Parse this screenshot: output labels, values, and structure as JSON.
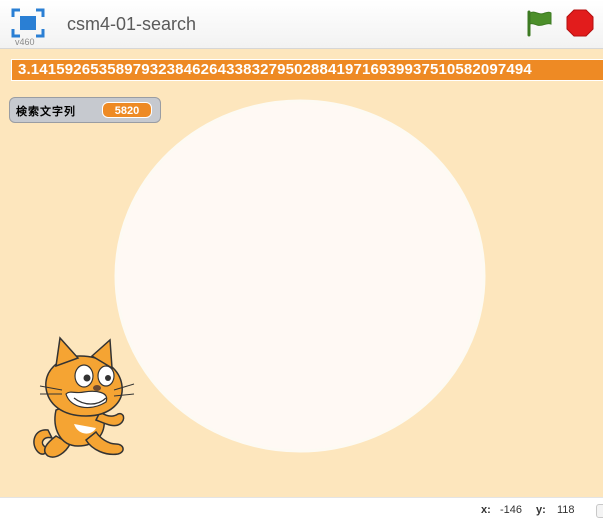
{
  "header": {
    "title": "csm4-01-search",
    "version": "v460"
  },
  "monitors": {
    "pi_digits": "3.14159265358979323846264338327950288419716939937510582097494",
    "var_label": "検索文字列",
    "var_value": "5820"
  },
  "footer": {
    "x_label": "x:",
    "x_value": "-146",
    "y_label": "y:",
    "y_value": "118"
  },
  "colors": {
    "stage_bg": "#fde6bd",
    "monitor_orange": "#ee8a24",
    "circle": "#fff9f4",
    "flag": "#4c8f2a",
    "stop": "#e21c1c"
  }
}
